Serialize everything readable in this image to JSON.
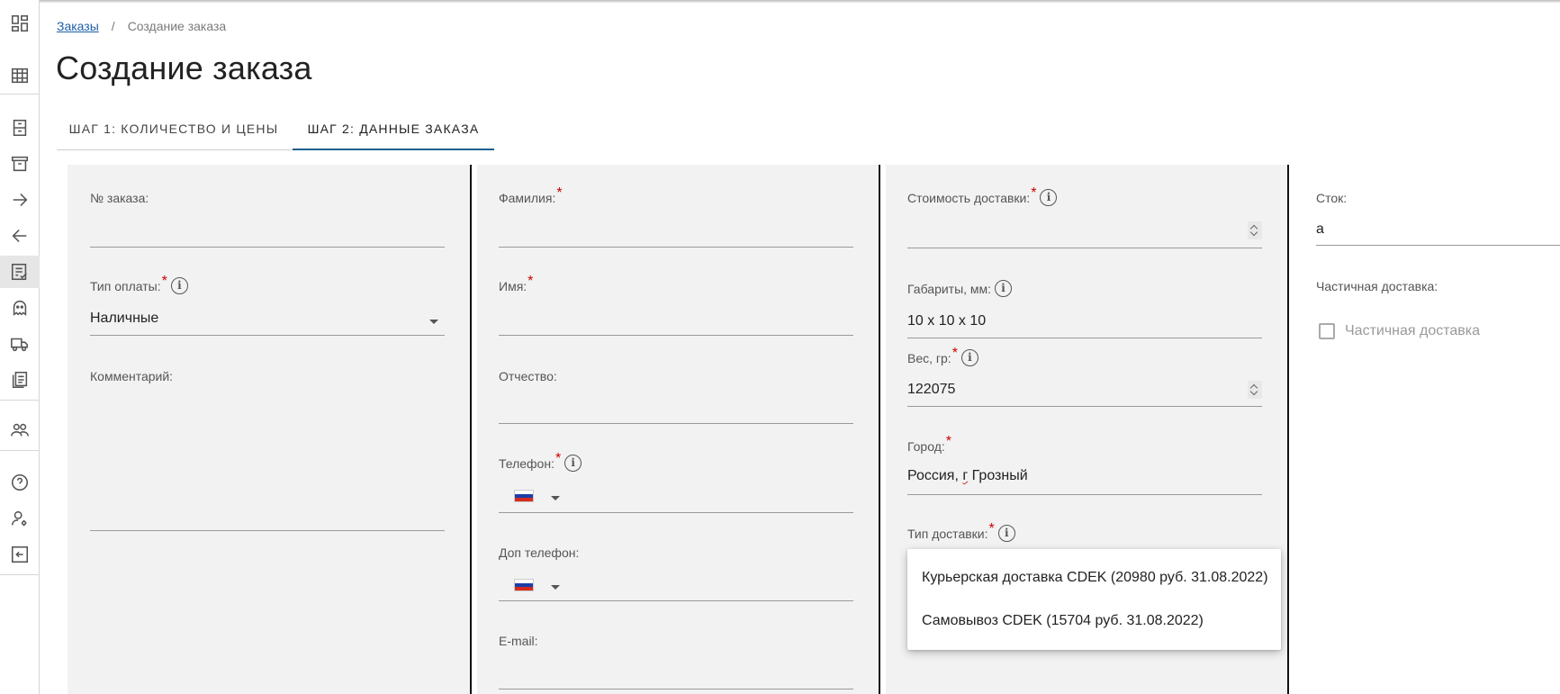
{
  "breadcrumb": {
    "root": "Заказы",
    "separator": "/",
    "current": "Создание заказа"
  },
  "page_title": "Создание заказа",
  "tabs": [
    {
      "label": "ШАГ 1: КОЛИЧЕСТВО И ЦЕНЫ"
    },
    {
      "label": "ШАГ 2: ДАННЫЕ ЗАКАЗА"
    }
  ],
  "sidebar": {
    "items": [
      "dashboard-icon",
      "grid-icon",
      "cabinet-icon",
      "archive-icon",
      "arrow-right-icon",
      "arrow-left-icon",
      "checklist-icon",
      "ghost-icon",
      "truck-icon",
      "documents-icon",
      "users-icon",
      "help-icon",
      "user-settings-icon",
      "logout-icon"
    ],
    "active_index": 6
  },
  "col1": {
    "order_no_label": "№ заказа:",
    "order_no_value": "",
    "payment_label": "Тип оплаты:",
    "payment_value": "Наличные",
    "comment_label": "Комментарий:",
    "required_mark": "*"
  },
  "col2": {
    "lastname_label": "Фамилия:",
    "firstname_label": "Имя:",
    "patronymic_label": "Отчество:",
    "phone_label": "Телефон:",
    "alt_phone_label": "Доп телефон:",
    "email_label": "E-mail:",
    "required_mark": "*"
  },
  "col3": {
    "delivery_cost_label": "Стоимость доставки:",
    "dimensions_label": "Габариты, мм:",
    "dimensions_value": "10 x 10 x 10",
    "weight_label": "Вес, гр:",
    "weight_value": "122075",
    "city_label": "Город:",
    "city_prefix": "Россия, ",
    "city_squiggle": "г",
    "city_rest": " Грозный",
    "delivery_type_label": "Тип доставки:",
    "required_mark": "*",
    "info_glyph": "i"
  },
  "col4": {
    "stock_label": "Сток:",
    "stock_value": "a",
    "partial_label": "Частичная доставка:",
    "partial_checkbox_label": "Частичная доставка"
  },
  "dropdown": {
    "options": [
      "Курьерская доставка CDEK (20980 руб. 31.08.2022)",
      "Самовывоз CDEK (15704 руб. 31.08.2022)"
    ]
  },
  "colors": {
    "link": "#1f5fa8",
    "tab_active_underline": "#1f5f8f",
    "required": "#cc0000",
    "panel_bg": "#f2f2f2"
  }
}
